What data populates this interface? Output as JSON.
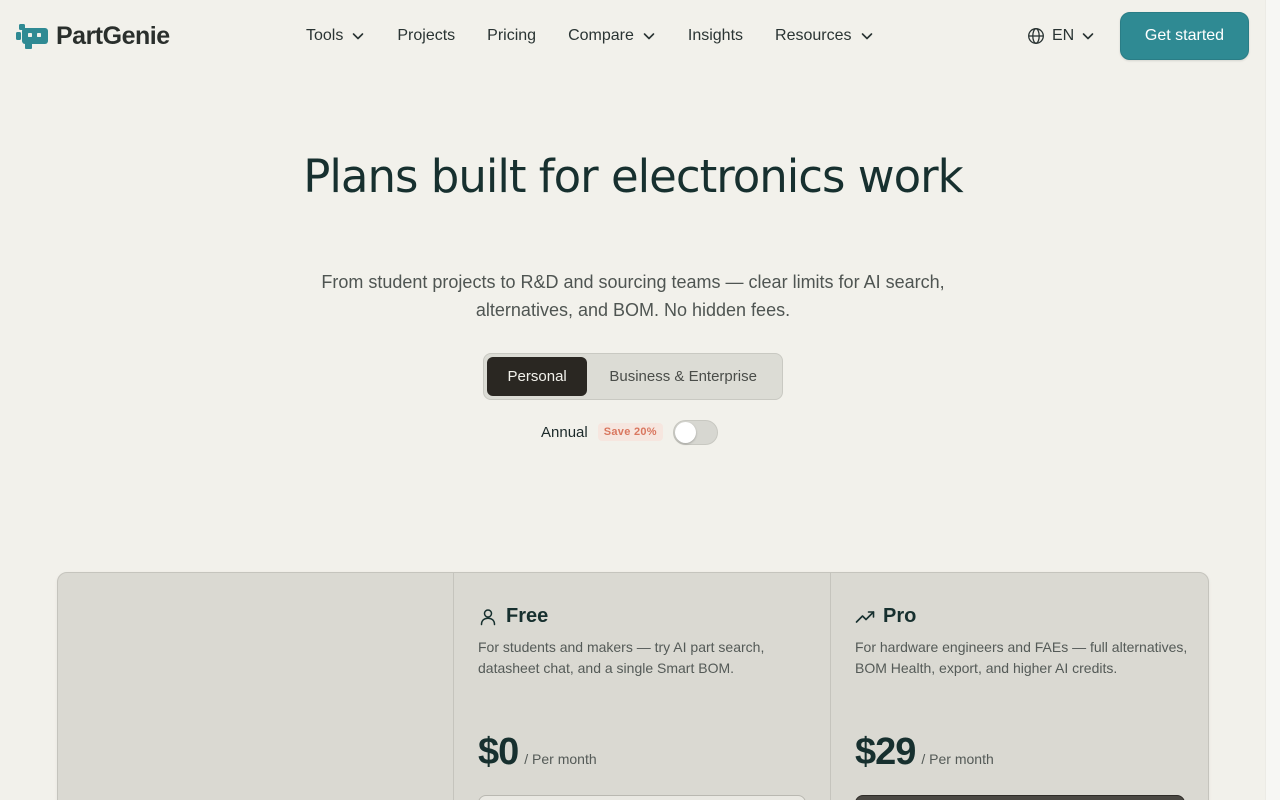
{
  "brand": {
    "name": "PartGenie",
    "logo_icon": "robot-logo-icon",
    "accent_color": "#2f8a93"
  },
  "nav": {
    "items": [
      {
        "label": "Tools",
        "has_dropdown": true
      },
      {
        "label": "Projects",
        "has_dropdown": false
      },
      {
        "label": "Pricing",
        "has_dropdown": false
      },
      {
        "label": "Compare",
        "has_dropdown": true
      },
      {
        "label": "Insights",
        "has_dropdown": false
      },
      {
        "label": "Resources",
        "has_dropdown": true
      }
    ]
  },
  "language": {
    "label": "EN",
    "icon": "globe-icon"
  },
  "cta": {
    "label": "Get started"
  },
  "hero": {
    "title": "Plans built for electronics work",
    "subtitle": "From student projects to R&D and sourcing teams — clear limits for AI search, alternatives, and BOM. No hidden fees."
  },
  "plan_type": {
    "options": [
      "Personal",
      "Business & Enterprise"
    ],
    "selected": "Personal"
  },
  "billing": {
    "label": "Annual",
    "badge": "Save 20%",
    "annual_enabled": false
  },
  "plans": [
    {
      "name": "Free",
      "icon": "user-icon",
      "description": "For students and makers — try AI part search, datasheet chat, and a single Smart BOM.",
      "price": "$0",
      "period": "/ Per month"
    },
    {
      "name": "Pro",
      "icon": "trending-up-icon",
      "description": "For hardware engineers and FAEs — full alternatives, BOM Health, export, and higher AI credits.",
      "price": "$29",
      "period": "/ Per month"
    }
  ]
}
